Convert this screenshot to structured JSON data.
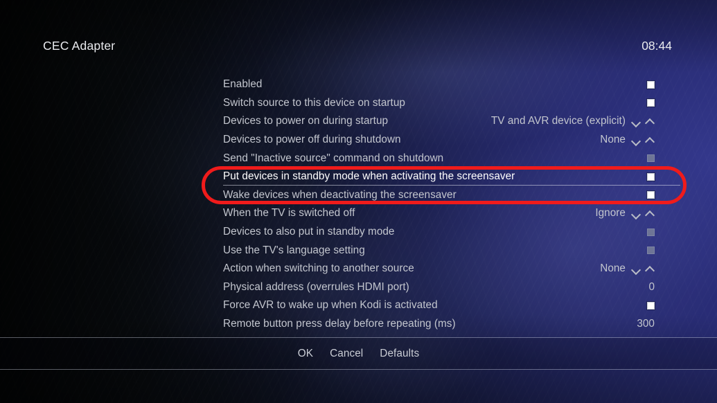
{
  "header": {
    "title": "CEC Adapter",
    "clock": "08:44"
  },
  "settings": {
    "rows": [
      {
        "label": "Enabled",
        "control": "checkbox",
        "state": "on"
      },
      {
        "label": "Switch source to this device on startup",
        "control": "checkbox",
        "state": "on"
      },
      {
        "label": "Devices to power on during startup",
        "control": "spinner",
        "value": "TV and AVR device (explicit)"
      },
      {
        "label": "Devices to power off during shutdown",
        "control": "spinner",
        "value": "None"
      },
      {
        "label": "Send \"Inactive source\" command on shutdown",
        "control": "checkbox",
        "state": "dim"
      },
      {
        "label": "Put devices in standby mode when activating the screensaver",
        "control": "checkbox",
        "state": "on",
        "selected": true
      },
      {
        "label": "Wake devices when deactivating the screensaver",
        "control": "checkbox",
        "state": "on"
      },
      {
        "label": "When the TV is switched off",
        "control": "spinner",
        "value": "Ignore"
      },
      {
        "label": "Devices to also put in standby mode",
        "control": "checkbox",
        "state": "dim"
      },
      {
        "label": "Use the TV's language setting",
        "control": "checkbox",
        "state": "dim"
      },
      {
        "label": "Action when switching to another source",
        "control": "spinner",
        "value": "None"
      },
      {
        "label": "Physical address (overrules HDMI port)",
        "control": "text",
        "value": "0"
      },
      {
        "label": "Force AVR to wake up when Kodi is activated",
        "control": "checkbox",
        "state": "on"
      },
      {
        "label": "Remote button press delay before repeating (ms)",
        "control": "text",
        "value": "300"
      }
    ]
  },
  "footer": {
    "buttons": [
      "OK",
      "Cancel",
      "Defaults"
    ]
  },
  "annotation": {
    "color": "#f01b1b",
    "shape": "ellipse-highlight"
  },
  "icons": {
    "chevron_down": "chevron-down-icon",
    "chevron_up": "chevron-up-icon"
  }
}
